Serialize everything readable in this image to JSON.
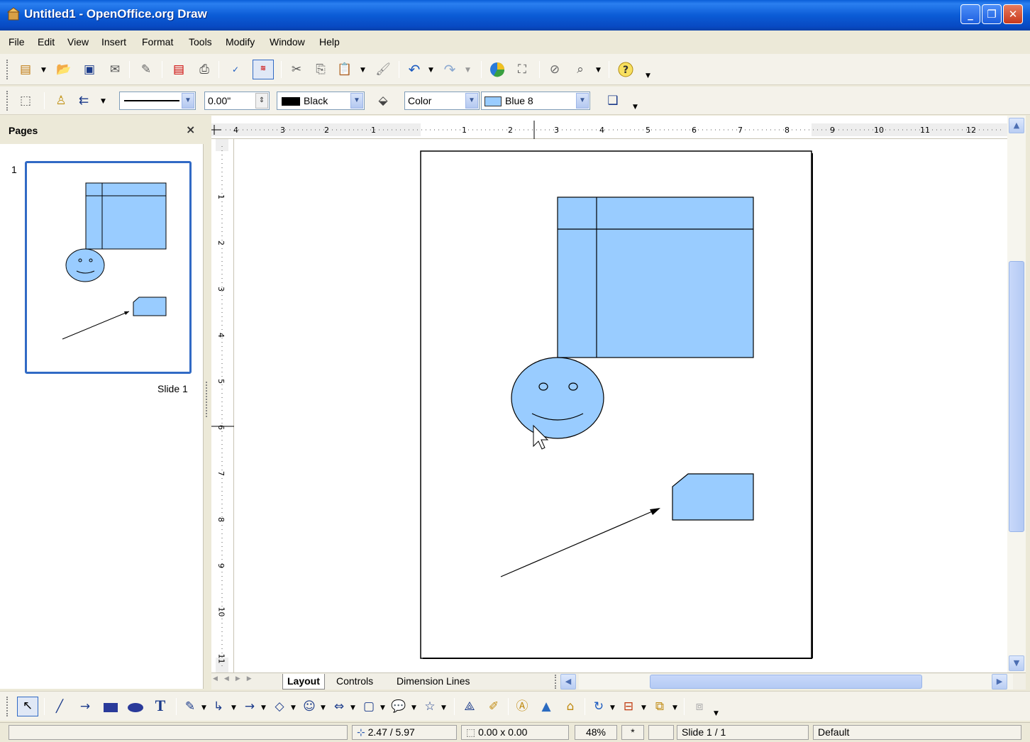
{
  "window": {
    "title": "Untitled1 - OpenOffice.org Draw",
    "minimize_glyph": "_",
    "maximize_glyph": "❐",
    "close_glyph": "✕"
  },
  "menu": {
    "items": [
      "File",
      "Edit",
      "View",
      "Insert",
      "Format",
      "Tools",
      "Modify",
      "Window",
      "Help"
    ]
  },
  "standard_toolbar": {
    "icons": [
      "new-icon",
      "open-icon",
      "save-icon",
      "email-icon",
      "edit-file-icon",
      "export-pdf-icon",
      "print-icon",
      "spellcheck-icon",
      "autospellcheck-icon",
      "cut-icon",
      "copy-icon",
      "paste-icon",
      "format-paintbrush-icon",
      "undo-icon",
      "redo-icon",
      "chart-icon",
      "gallery-icon",
      "navigator-icon",
      "zoom-icon",
      "help-icon"
    ]
  },
  "line_fill_toolbar": {
    "line_width": "0.00\"",
    "line_color": "Black",
    "line_color_hex": "#000000",
    "area_style": "Color",
    "area_fill": "Blue 8",
    "area_fill_hex": "#99ccff"
  },
  "pages_pane": {
    "title": "Pages",
    "close_glyph": "×",
    "page_number": "1",
    "slide_label": "Slide 1"
  },
  "rulers": {
    "h_labels": [
      "4",
      "3",
      "2",
      "1",
      "1",
      "2",
      "3",
      "4",
      "5",
      "6",
      "7",
      "8",
      "9",
      "10",
      "11",
      "12"
    ],
    "v_labels": [
      "1",
      "2",
      "3",
      "4",
      "5",
      "6",
      "7",
      "8",
      "9",
      "10",
      "11"
    ]
  },
  "tabs": {
    "items": [
      "Layout",
      "Controls",
      "Dimension Lines"
    ],
    "active": "Layout"
  },
  "status": {
    "position": "2.47 / 5.97",
    "size": "0.00 x 0.00",
    "zoom": "48%",
    "modified": "*",
    "slide": "Slide 1 / 1",
    "layout": "Default"
  },
  "colors": {
    "shape_fill": "#99ccff",
    "titlebar": "#0b5cd6",
    "selection": "#316ac5"
  }
}
